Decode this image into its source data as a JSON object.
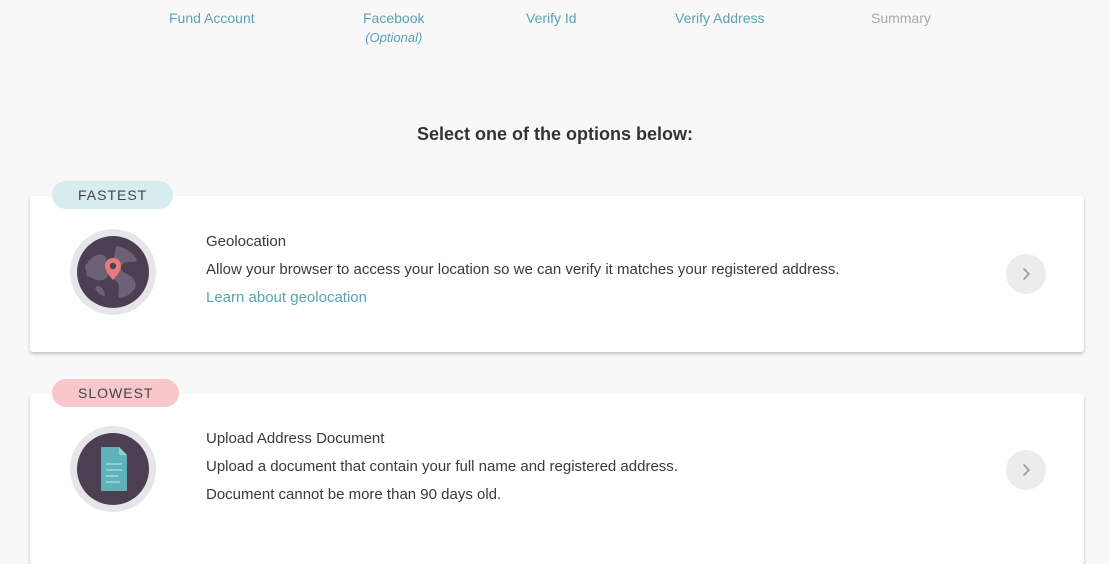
{
  "stepper": {
    "steps": [
      {
        "label": "Fund Account",
        "sub": "",
        "state": "complete"
      },
      {
        "label": "Facebook",
        "sub": "(Optional)",
        "state": "complete"
      },
      {
        "label": "Verify Id",
        "sub": "",
        "state": "complete"
      },
      {
        "label": "Verify Address",
        "sub": "",
        "state": "current"
      },
      {
        "label": "Summary",
        "sub": "",
        "state": "upcoming"
      }
    ]
  },
  "main": {
    "heading": "Select one of the options below:",
    "options": [
      {
        "tag": "FASTEST",
        "tag_color": "#d7ecee",
        "icon": "globe-location-icon",
        "title": "Geolocation",
        "description": "Allow your browser to access your location so we can verify it matches your registered address.",
        "link": "Learn about geolocation"
      },
      {
        "tag": "SLOWEST",
        "tag_color": "#f7c7cb",
        "icon": "document-icon",
        "title": "Upload Address Document",
        "description": "Upload a document that contain your full name and registered address.",
        "description_2": "Document cannot be more than 90 days old."
      }
    ]
  },
  "colors": {
    "accent": "#5aa2b4",
    "badge_dark": "#4d3f52",
    "pin": "#e57b7b",
    "document": "#5fb3b8"
  }
}
